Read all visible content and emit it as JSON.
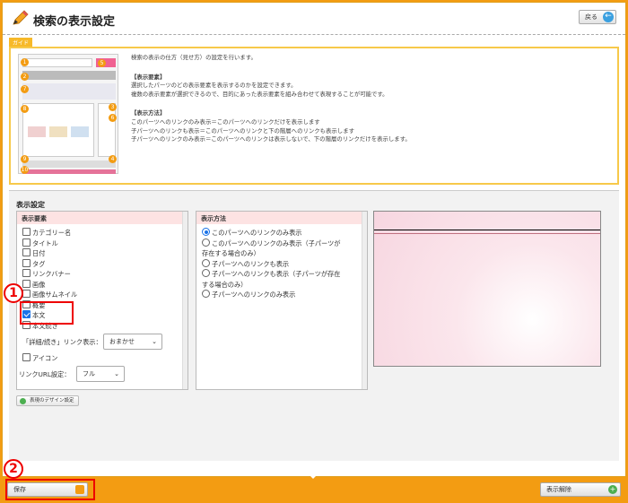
{
  "header": {
    "title": "検索の表示設定",
    "back_label": "戻る"
  },
  "guide": {
    "tag": "ガイド",
    "intro": "検索の表示の仕方（見せ方）の設定を行います。",
    "h1": "【表示要素】",
    "p1a": "選択したパーツのどの表示要素を表示するのかを設定できます。",
    "p1b": "複数の表示要素が選択できるので、目的にあった表示要素を組み合わせて表現することが可能です。",
    "h2": "【表示方法】",
    "p2a": "このパーツへのリンクのみ表示＝このパーツへのリンクだけを表示します",
    "p2b": "子パーツへのリンクも表示＝このパーツへのリンクと下の階層へのリンクも表示します",
    "p2c": "子パーツへのリンクのみ表示＝このパーツへのリンクは表示しないで、下の階層のリンクだけを表示します。",
    "nums": [
      "1",
      "2",
      "3",
      "4",
      "5",
      "6",
      "7",
      "8",
      "9",
      "10"
    ]
  },
  "settings": {
    "title": "表示設定",
    "elements": {
      "header": "表示要素",
      "items": [
        {
          "label": "カテゴリー名",
          "checked": false
        },
        {
          "label": "タイトル",
          "checked": false
        },
        {
          "label": "日付",
          "checked": false
        },
        {
          "label": "タグ",
          "checked": false
        },
        {
          "label": "リンクバナー",
          "checked": false
        },
        {
          "label": "画像",
          "checked": false
        },
        {
          "label": "画像サムネイル",
          "checked": false
        },
        {
          "label": "概要",
          "checked": false
        },
        {
          "label": "本文",
          "checked": true
        },
        {
          "label": "本文続き",
          "checked": false
        }
      ],
      "detail_link_label": "「詳細/続き」リンク表示：",
      "detail_link_value": "おまかせ",
      "icon_label": "アイコン",
      "url_label": "リンクURL設定：",
      "url_value": "フル"
    },
    "method": {
      "header": "表示方法",
      "options": [
        {
          "line1": "このパーツへのリンクのみ表示",
          "line2": "",
          "selected": true
        },
        {
          "line1": "このパーツへのリンクのみ表示（子パーツが",
          "line2": "存在する場合のみ）",
          "selected": false
        },
        {
          "line1": "子パーツへのリンクも表示",
          "line2": "",
          "selected": false
        },
        {
          "line1": "子パーツへのリンクも表示（子パーツが存在",
          "line2": "する場合のみ）",
          "selected": false
        },
        {
          "line1": "子パーツへのリンクのみ表示",
          "line2": "",
          "selected": false
        }
      ]
    },
    "design_button": "表現のデザイン設定"
  },
  "footer": {
    "save_label": "保存",
    "unset_label": "表示解除"
  },
  "annotations": {
    "marker1": "1",
    "marker2": "2"
  },
  "colors": {
    "accent": "#f39c12",
    "highlight": "#e00000",
    "check": "#1a73e8"
  }
}
